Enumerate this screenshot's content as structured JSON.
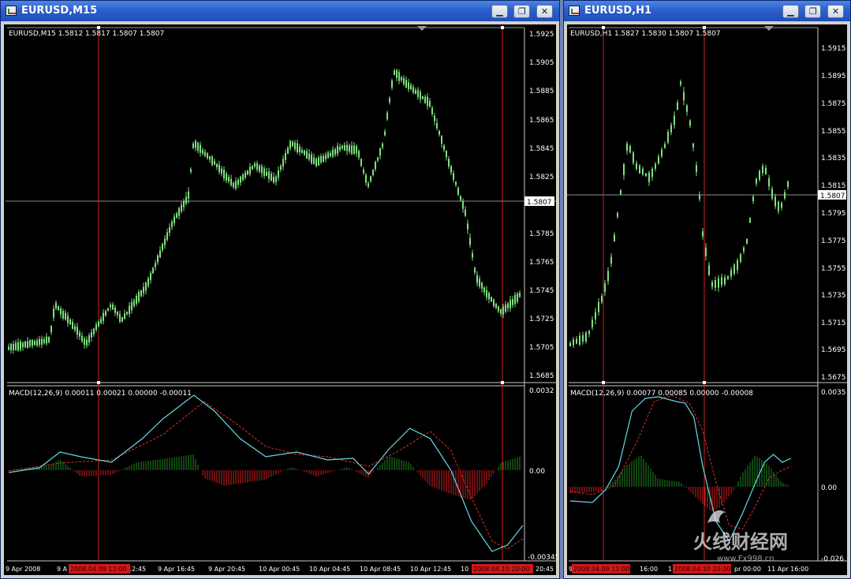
{
  "windows": [
    {
      "id": "m15",
      "title": "EURUSD,M15",
      "buttons": [
        "▁",
        "❐",
        "✕"
      ],
      "ohlc_label": "EURUSD,M15  1.5812 1.5817 1.5807 1.5807",
      "macd_label": "MACD(12,26,9) 0.00011 0.00021 0.00000 -0.00011",
      "current_price": "1.5807",
      "price_ticks": [
        "1.5925",
        "1.5905",
        "1.5885",
        "1.5865",
        "1.5845",
        "1.5825",
        "1.5807",
        "1.5785",
        "1.5765",
        "1.5745",
        "1.5725",
        "1.5705",
        "1.5685"
      ],
      "macd_ticks": [
        "0.0032",
        "0.00",
        "-0.00345"
      ],
      "time_labels": [
        "9 Apr 2008",
        "9 A",
        "12:45",
        "9 Apr 16:45",
        "9 Apr 20:45",
        "10 Apr 00:45",
        "10 Apr 04:45",
        "10 Apr 08:45",
        "10 Apr 12:45",
        "10",
        "20:45"
      ],
      "time_markers": [
        "2008.04.09 12:00",
        "2008.04.10 20:00"
      ]
    },
    {
      "id": "h1",
      "title": "EURUSD,H1",
      "buttons": [
        "▁",
        "❐",
        "✕"
      ],
      "ohlc_label": "EURUSD,H1  1.5827 1.5830 1.5807 1.5807",
      "macd_label": "MACD(12,26,9) 0.00077 0.00085 0.00000 -0.00008",
      "current_price": "1.5807",
      "price_ticks": [
        "1.5915",
        "1.5895",
        "1.5875",
        "1.5855",
        "1.5835",
        "1.5815",
        "1.5807",
        "1.5795",
        "1.5775",
        "1.5755",
        "1.5735",
        "1.5715",
        "1.5695",
        "1.5675"
      ],
      "macd_ticks": [
        "0.0035",
        "0.00",
        "-0.026"
      ],
      "time_labels": [
        "9",
        "16:00",
        "1",
        "pr 00:00",
        "11 Apr 16:00"
      ],
      "time_markers": [
        "2008.04.09 11:00",
        "2008.04.10 20:00"
      ]
    }
  ],
  "watermark": {
    "title": "火线财经网",
    "url": "www.Fx998.cn"
  },
  "colors": {
    "background": "#000000",
    "candles": "#7fe07f",
    "macd_main": "#66d9e8",
    "macd_signal": "#e03030",
    "hist_pos": "#1e8a1e",
    "hist_neg": "#d42020",
    "vline": "#d02020",
    "text": "#ffffff",
    "hline": "#8c8c8c"
  }
}
